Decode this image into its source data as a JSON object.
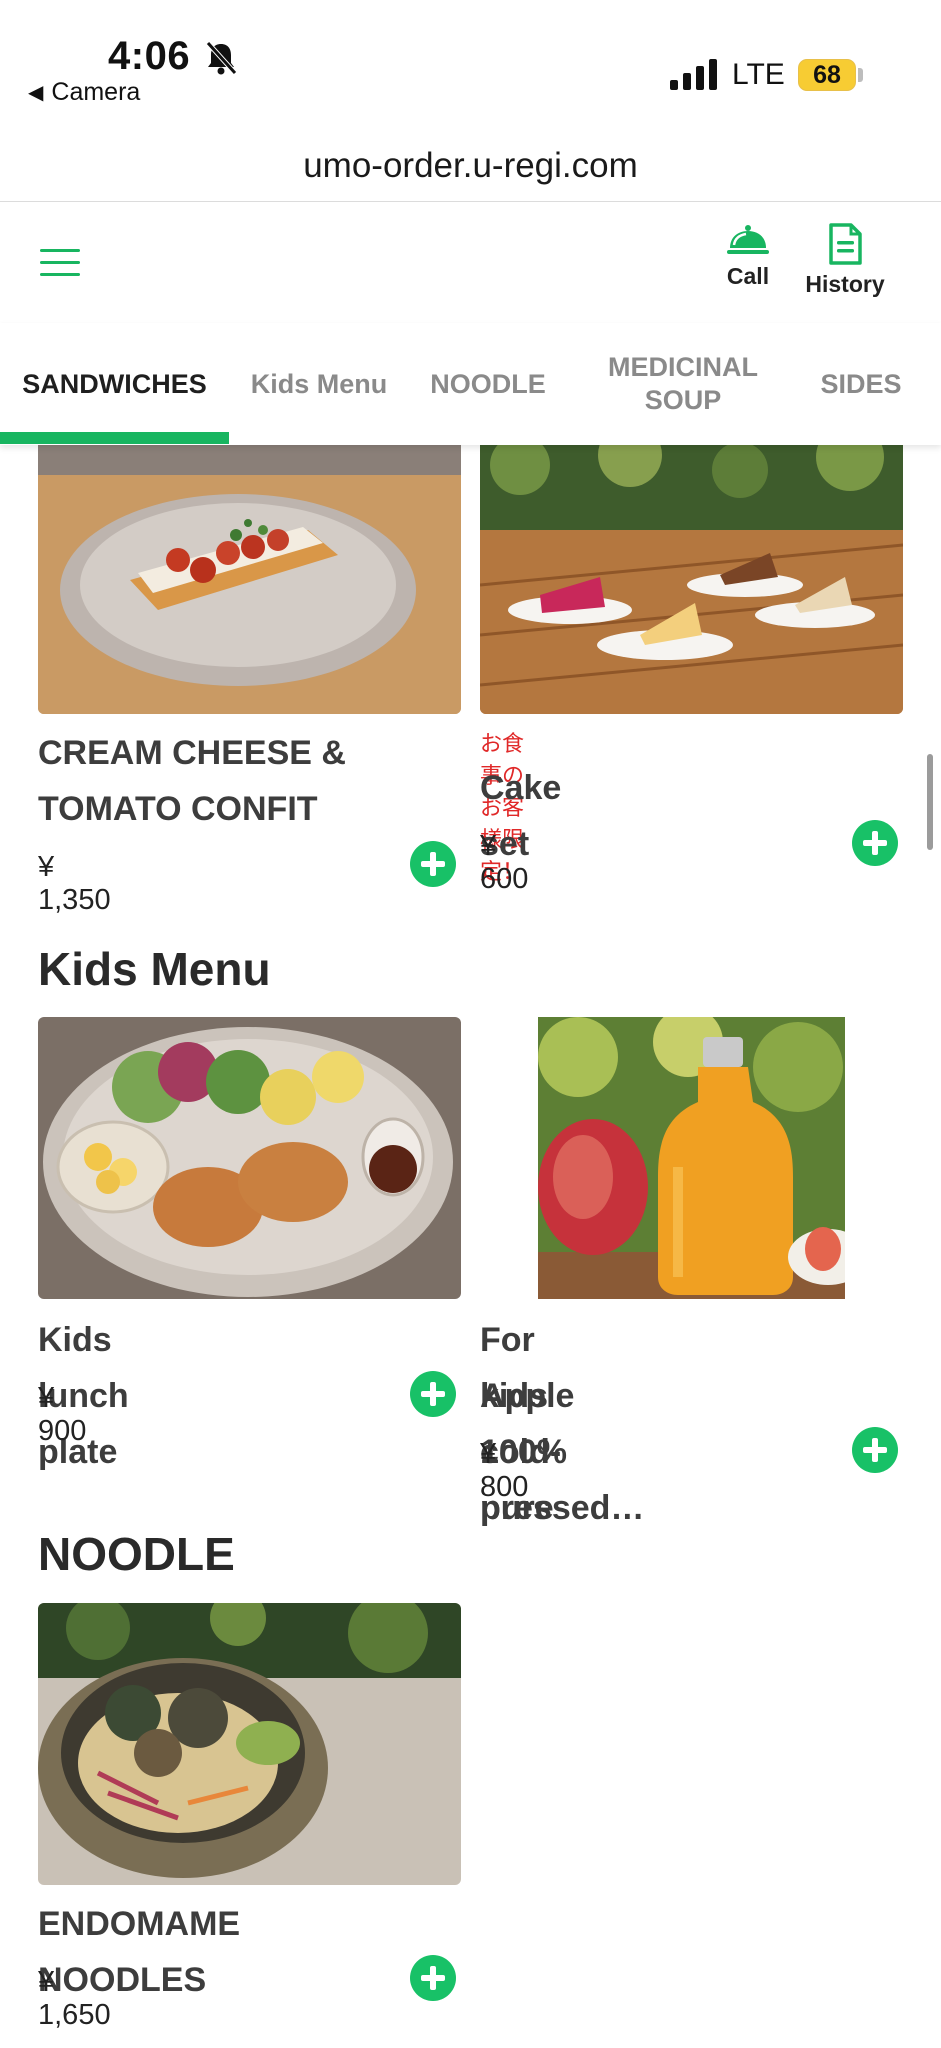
{
  "status_bar": {
    "time": "4:06",
    "back_label": "Camera",
    "network": "LTE",
    "battery": "68"
  },
  "browser": {
    "url": "umo-order.u-regi.com"
  },
  "header": {
    "call_label": "Call",
    "history_label": "History",
    "accent_color": "#18b560"
  },
  "tabs": [
    {
      "label": "SANDWICHES",
      "active": true
    },
    {
      "label": "Kids Menu",
      "active": false
    },
    {
      "label": "NOODLE",
      "active": false
    },
    {
      "label": "MEDICINAL SOUP",
      "active": false
    },
    {
      "label": "SIDES",
      "active": false
    }
  ],
  "sandwiches": {
    "items": [
      {
        "name_line1": "CREAM CHEESE &",
        "name_line2": "TOMATO CONFIT",
        "price": "¥ 1,350"
      },
      {
        "note": "お食事のお客様限定！",
        "name": "Cake set",
        "price": "¥ 600"
      }
    ]
  },
  "kids_menu": {
    "title": "Kids Menu",
    "items": [
      {
        "name": "Kids lunch plate",
        "price": "¥ 900"
      },
      {
        "name_line1": "For kids 100% pure",
        "name_line2": "Apple cold-pressed…",
        "price": "¥ 800"
      }
    ]
  },
  "noodle": {
    "title": "NOODLE",
    "items": [
      {
        "name": "ENDOMAME NOODLES",
        "price": "¥ 1,650"
      }
    ]
  }
}
